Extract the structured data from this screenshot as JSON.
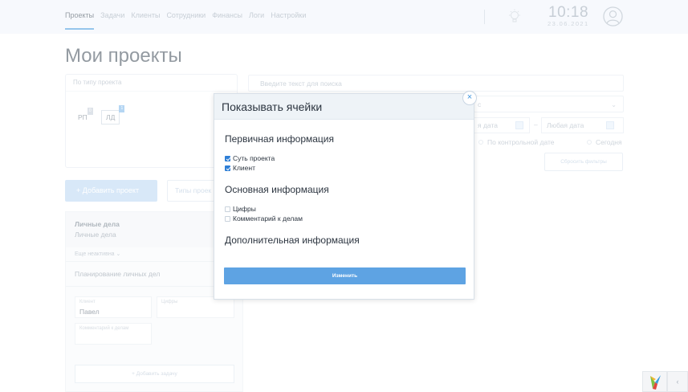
{
  "nav": {
    "items": [
      "Проекты",
      "Задачи",
      "Клиенты",
      "Сотрудники",
      "Финансы",
      "Логи",
      "Настройки"
    ],
    "active": "Проекты"
  },
  "header": {
    "time": "10:18",
    "date": "23.06.2021",
    "icons": [
      "lightbulb-icon",
      "user-avatar-icon"
    ]
  },
  "page": {
    "title": "Мои проекты"
  },
  "filters": {
    "type_label": "По типу проекта",
    "chips": [
      {
        "label": "РП",
        "badge": "0"
      },
      {
        "label": "ЛД",
        "badge": "1"
      }
    ],
    "search_placeholder": "Введите текст для поиска",
    "select_value": "с",
    "date_from": "я дата",
    "date_separator": "–",
    "date_to": "Любая дата",
    "radio_control_date": "По контрольной дате",
    "radio_today": "Сегодня",
    "reset_label": "Сбросить фильтры"
  },
  "actions": {
    "add_project": "+  Добавить проект",
    "project_types": "Типы проек"
  },
  "project": {
    "name": "Личные дела",
    "client": "Личные дела",
    "inactive_link": "Еще неактивна ⌄",
    "task": "Планирование личных дел",
    "client_label": "Клиент",
    "client_value": "Павел",
    "numbers_label": "Цифры",
    "comment_label": "Комментарий к делам",
    "add_task": "+          Добавить задачу"
  },
  "modal": {
    "title": "Показывать ячейки",
    "close": "×",
    "sections": [
      {
        "title": "Первичная информация",
        "items": [
          {
            "label": "Суть проекта",
            "checked": true
          },
          {
            "label": "Клиент",
            "checked": true
          }
        ]
      },
      {
        "title": "Основная информация",
        "items": [
          {
            "label": "Цифры",
            "checked": false
          },
          {
            "label": "Комментарий к делам",
            "checked": false
          }
        ]
      },
      {
        "title": "Дополнительная информация",
        "items": []
      }
    ],
    "submit": "Изменить"
  },
  "widgets": {
    "collapse": "‹"
  },
  "colors": {
    "accent": "#3f95dd",
    "button_primary": "#5ea3e3",
    "checkbox_checked": "#2f7fd6",
    "nav_bg": "#f0f5fb"
  }
}
